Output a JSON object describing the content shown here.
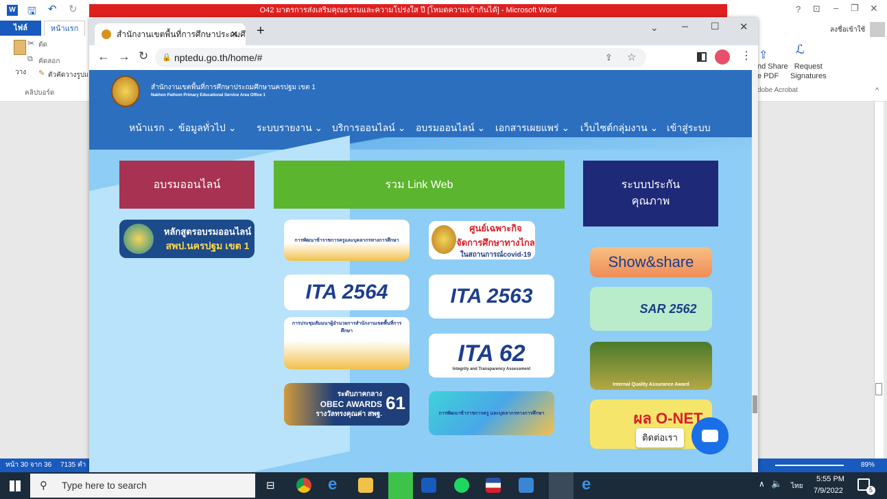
{
  "word": {
    "title": "O42 มาตรการส่งเสริมคุณธรรมและความโปร่งใส ปี [โหมดความเข้ากันได้] - Microsoft Word",
    "tab_file": "ไฟล์",
    "tab_home": "หน้าแรก",
    "cut": "ตัด",
    "copy": "คัดลอก",
    "format_painter": "ตัวคัดวางรูปแบ",
    "paste": "วาง",
    "clipboard": "คลิปบอร์ด",
    "signin": "ลงชื่อเข้าใช้",
    "share_pdf": "nd Share\ne PDF",
    "request_sig": "Request\nSignatures",
    "acrobat": "dobe Acrobat",
    "status_page": "หน้า 30 จาก 36",
    "status_words": "7135 คำ",
    "zoom": "89%"
  },
  "browser": {
    "tab_title": "สำนักงานเขตพื้นที่การศึกษาประถมศึก",
    "url": "nptedu.go.th/home/#"
  },
  "site": {
    "org_name_th": "สำนักงานเขตพื้นที่การศึกษาประถมศึกษานครปฐม เขต 1",
    "org_name_en": "Nakhon Pathom Primary Educational Service Area Office 1",
    "nav": [
      "หน้าแรก ⌄",
      "ข้อมูลทั่วไป ⌄",
      "ระบบรายงาน ⌄",
      "บริการออนไลน์ ⌄",
      "อบรมออนไลน์ ⌄",
      "เอกสารเผยแพร่ ⌄",
      "เว็บไซต์กลุ่มงาน ⌄",
      "เข้าสู่ระบบ"
    ],
    "block_training": "อบรมออนไลน์",
    "block_links": "รวม Link Web",
    "block_quality": "ระบบประกัน\nคุณภาพ",
    "course_title": "หลักสูตรอบรมออนไลน์",
    "course_sub": "สพป.นครปฐม เขต 1",
    "banner_dev": "การพัฒนาข้าราชการครูและบุคลากรทางการศึกษา",
    "banner_center_1": "ศูนย์เฉพาะกิจ",
    "banner_center_2": "จัดการศึกษาทางไกล",
    "banner_center_3": "ในสถานการณ์covid-19",
    "ita_2564": "ITA 2564",
    "ita_2563": "ITA 2563",
    "ita_62": "ITA 62",
    "ita_62_sub": "Integrity and Transparency Assessment",
    "banner_meeting": "การประชุมสัมมนาผู้อำนวยการสำนักงานเขตพื้นที่การศึกษา",
    "obec_region": "ระดับภาคกลาง",
    "obec_title": "OBEC AWARDS",
    "obec_sub": "รางวัลทรงคุณค่า สพฐ.",
    "obec_num": "61",
    "banner_teacher_dev": "การพัฒนาข้าราชการครู และบุคลากรทางการศึกษา",
    "show_share": "Show&share",
    "sar": "SAR 2562",
    "iqa": "Internal Quality Assurance Award",
    "onet": "ผล O-NET",
    "chat_label": "ติดต่อเรา"
  },
  "taskbar": {
    "search_placeholder": "Type here to search",
    "lang": "ไทย",
    "time": "5:55 PM",
    "date": "7/9/2022",
    "notif_count": "5"
  },
  "colors": {
    "training_block": "#a83251",
    "links_block": "#5cb52e",
    "quality_block": "#1e2a78",
    "site_header": "#2c6fbf",
    "viewport_bg": "#8ecdf5"
  }
}
